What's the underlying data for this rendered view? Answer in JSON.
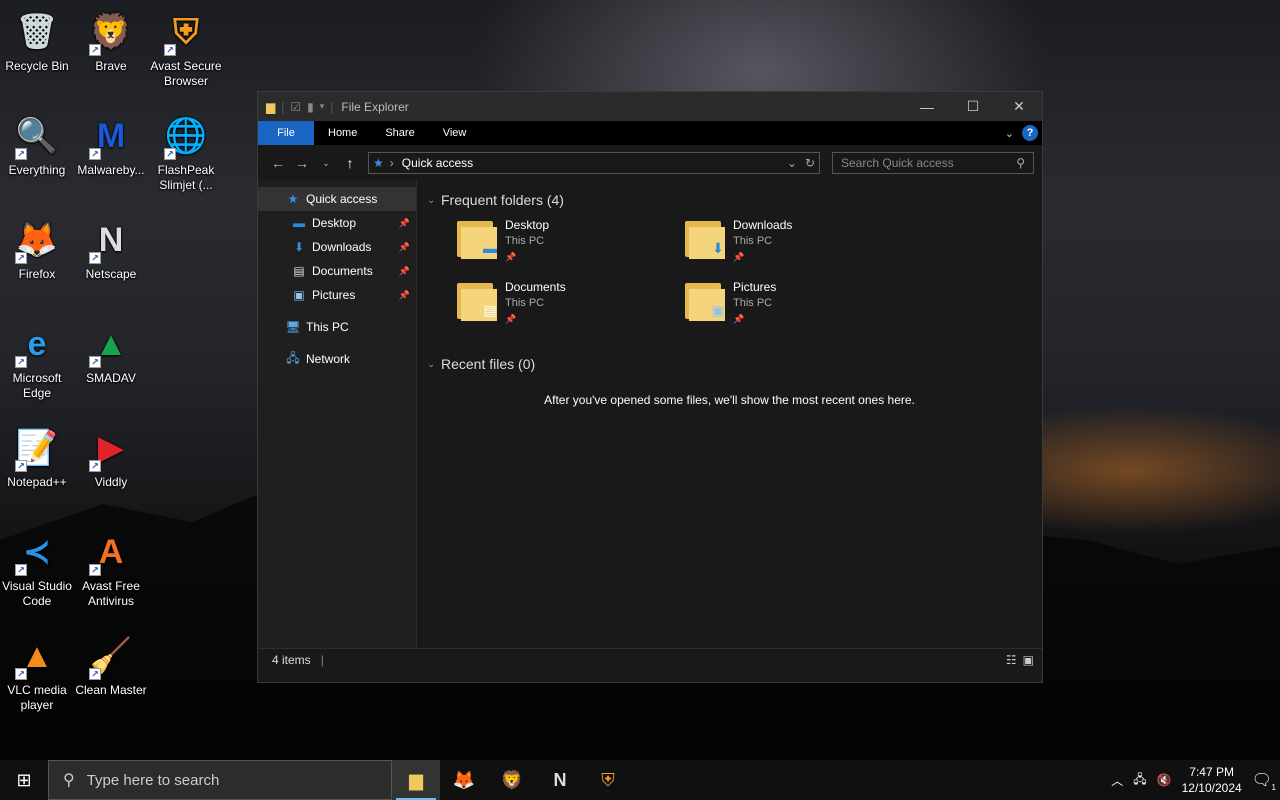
{
  "desktop": {
    "icons": [
      {
        "label": "Recycle Bin",
        "icon": "recycle-bin-icon",
        "glyph": "🗑"
      },
      {
        "label": "Brave",
        "icon": "brave-icon",
        "glyph": "🦁"
      },
      {
        "label": "Avast Secure Browser",
        "icon": "avast-browser-icon",
        "glyph": "⛨"
      },
      {
        "label": "Everything",
        "icon": "everything-icon",
        "glyph": "🔍"
      },
      {
        "label": "Malwareby...",
        "icon": "malwarebytes-icon",
        "glyph": "M"
      },
      {
        "label": "FlashPeak Slimjet (...",
        "icon": "slimjet-icon",
        "glyph": "🌐"
      },
      {
        "label": "Firefox",
        "icon": "firefox-icon",
        "glyph": "🦊"
      },
      {
        "label": "Netscape",
        "icon": "netscape-icon",
        "glyph": "N"
      },
      {
        "label": "Microsoft Edge",
        "icon": "edge-icon",
        "glyph": "e"
      },
      {
        "label": "SMADAV",
        "icon": "smadav-icon",
        "glyph": "▲"
      },
      {
        "label": "Notepad++",
        "icon": "notepadpp-icon",
        "glyph": "📝"
      },
      {
        "label": "Viddly",
        "icon": "viddly-icon",
        "glyph": "▶"
      },
      {
        "label": "Visual Studio Code",
        "icon": "vscode-icon",
        "glyph": "≺"
      },
      {
        "label": "Avast Free Antivirus",
        "icon": "avast-antivirus-icon",
        "glyph": "A"
      },
      {
        "label": "VLC media player",
        "icon": "vlc-icon",
        "glyph": "▲"
      },
      {
        "label": "Clean Master",
        "icon": "clean-master-icon",
        "glyph": "🧹"
      }
    ]
  },
  "window": {
    "title": "File Explorer",
    "ribbon_tabs": [
      "File",
      "Home",
      "Share",
      "View"
    ],
    "address": "Quick access",
    "search_placeholder": "Search Quick access",
    "nav": {
      "quick_access": "Quick access",
      "desktop": "Desktop",
      "downloads": "Downloads",
      "documents": "Documents",
      "pictures": "Pictures",
      "this_pc": "This PC",
      "network": "Network"
    },
    "frequent_header": "Frequent folders (4)",
    "folders": [
      {
        "name": "Desktop",
        "location": "This PC"
      },
      {
        "name": "Downloads",
        "location": "This PC"
      },
      {
        "name": "Documents",
        "location": "This PC"
      },
      {
        "name": "Pictures",
        "location": "This PC"
      }
    ],
    "recent_header": "Recent files (0)",
    "recent_empty": "After you've opened some files, we'll show the most recent ones here.",
    "status": "4 items"
  },
  "taskbar": {
    "search_placeholder": "Type here to search",
    "time": "7:47 PM",
    "date": "12/10/2024",
    "notification_count": "1"
  }
}
